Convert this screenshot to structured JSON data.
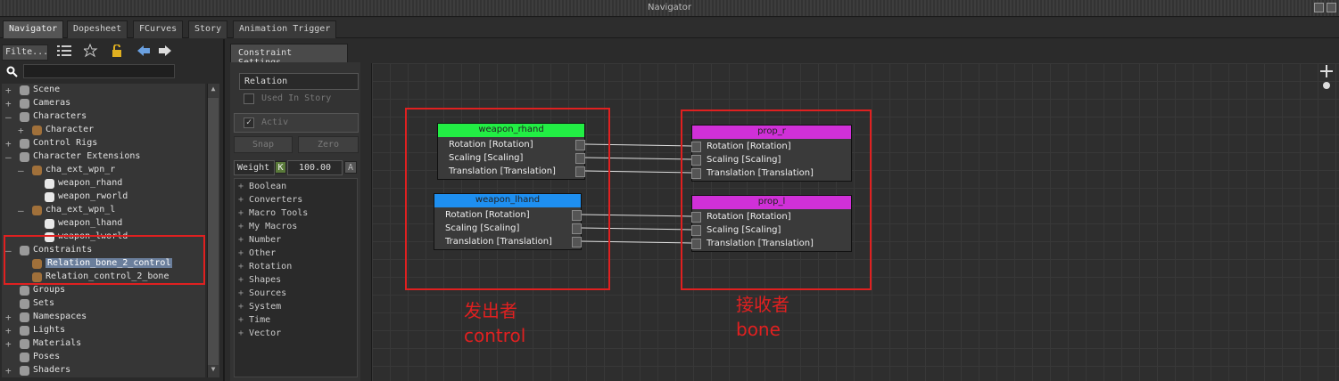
{
  "window": {
    "title": "Navigator"
  },
  "tabs": [
    "Navigator",
    "Dopesheet",
    "FCurves",
    "Story",
    "Animation Trigger"
  ],
  "left": {
    "filter_label": "Filte...",
    "tree": [
      {
        "label": "Scene",
        "depth": 0,
        "expander": "+",
        "selected": false
      },
      {
        "label": "Cameras",
        "depth": 0,
        "expander": "+",
        "selected": false
      },
      {
        "label": "Characters",
        "depth": 0,
        "expander": "-",
        "selected": false
      },
      {
        "label": "Character",
        "depth": 1,
        "expander": "+",
        "selected": false
      },
      {
        "label": "Control Rigs",
        "depth": 0,
        "expander": "+",
        "selected": false
      },
      {
        "label": "Character Extensions",
        "depth": 0,
        "expander": "-",
        "selected": false
      },
      {
        "label": "cha_ext_wpn_r",
        "depth": 1,
        "expander": "-",
        "selected": false
      },
      {
        "label": "weapon_rhand",
        "depth": 2,
        "expander": "",
        "selected": false
      },
      {
        "label": "weapon_rworld",
        "depth": 2,
        "expander": "",
        "selected": false
      },
      {
        "label": "cha_ext_wpn_l",
        "depth": 1,
        "expander": "-",
        "selected": false
      },
      {
        "label": "weapon_lhand",
        "depth": 2,
        "expander": "",
        "selected": false
      },
      {
        "label": "weapon_lworld",
        "depth": 2,
        "expander": "",
        "selected": false
      },
      {
        "label": "Constraints",
        "depth": 0,
        "expander": "-",
        "selected": false
      },
      {
        "label": "Relation_bone_2_control",
        "depth": 1,
        "expander": "",
        "selected": true
      },
      {
        "label": "Relation_control_2_bone",
        "depth": 1,
        "expander": "",
        "selected": false
      },
      {
        "label": "Groups",
        "depth": 0,
        "expander": "",
        "selected": false
      },
      {
        "label": "Sets",
        "depth": 0,
        "expander": "",
        "selected": false
      },
      {
        "label": "Namespaces",
        "depth": 0,
        "expander": "+",
        "selected": false
      },
      {
        "label": "Lights",
        "depth": 0,
        "expander": "+",
        "selected": false
      },
      {
        "label": "Materials",
        "depth": 0,
        "expander": "+",
        "selected": false
      },
      {
        "label": "Poses",
        "depth": 0,
        "expander": "",
        "selected": false
      },
      {
        "label": "Shaders",
        "depth": 0,
        "expander": "+",
        "selected": false
      }
    ]
  },
  "settings": {
    "tab": "Constraint Settings",
    "relation": "Relation",
    "used_in_story": "Used In Story",
    "used_in_story_checked": false,
    "activ": "Activ",
    "activ_checked": true,
    "snap": "Snap",
    "zero": "Zero",
    "weight_label": "Weight",
    "weight_key": "K",
    "weight_value": "100.00",
    "weight_a": "A",
    "categories": [
      "Boolean",
      "Converters",
      "Macro Tools",
      "My Macros",
      "Number",
      "Other",
      "Rotation",
      "Shapes",
      "Sources",
      "System",
      "Time",
      "Vector"
    ]
  },
  "graph": {
    "nodes": [
      {
        "id": "weapon_rhand",
        "title": "weapon_rhand",
        "color": "#22ee44",
        "props": [
          "Rotation [Rotation]",
          "Scaling [Scaling]",
          "Translation [Translation]"
        ]
      },
      {
        "id": "weapon_lhand",
        "title": "weapon_lhand",
        "color": "#1e8ff0",
        "props": [
          "Rotation [Rotation]",
          "Scaling [Scaling]",
          "Translation [Translation]"
        ]
      },
      {
        "id": "prop_r",
        "title": "prop_r",
        "color": "#d030d8",
        "props": [
          "Rotation [Rotation]",
          "Scaling [Scaling]",
          "Translation [Translation]"
        ]
      },
      {
        "id": "prop_l",
        "title": "prop_l",
        "color": "#d030d8",
        "props": [
          "Rotation [Rotation]",
          "Scaling [Scaling]",
          "Translation [Translation]"
        ]
      }
    ],
    "annotations": {
      "sender_cn": "发出者",
      "sender_en": "control",
      "receiver_cn": "接收者",
      "receiver_en": "bone"
    },
    "annotation_color": "#e02020"
  }
}
